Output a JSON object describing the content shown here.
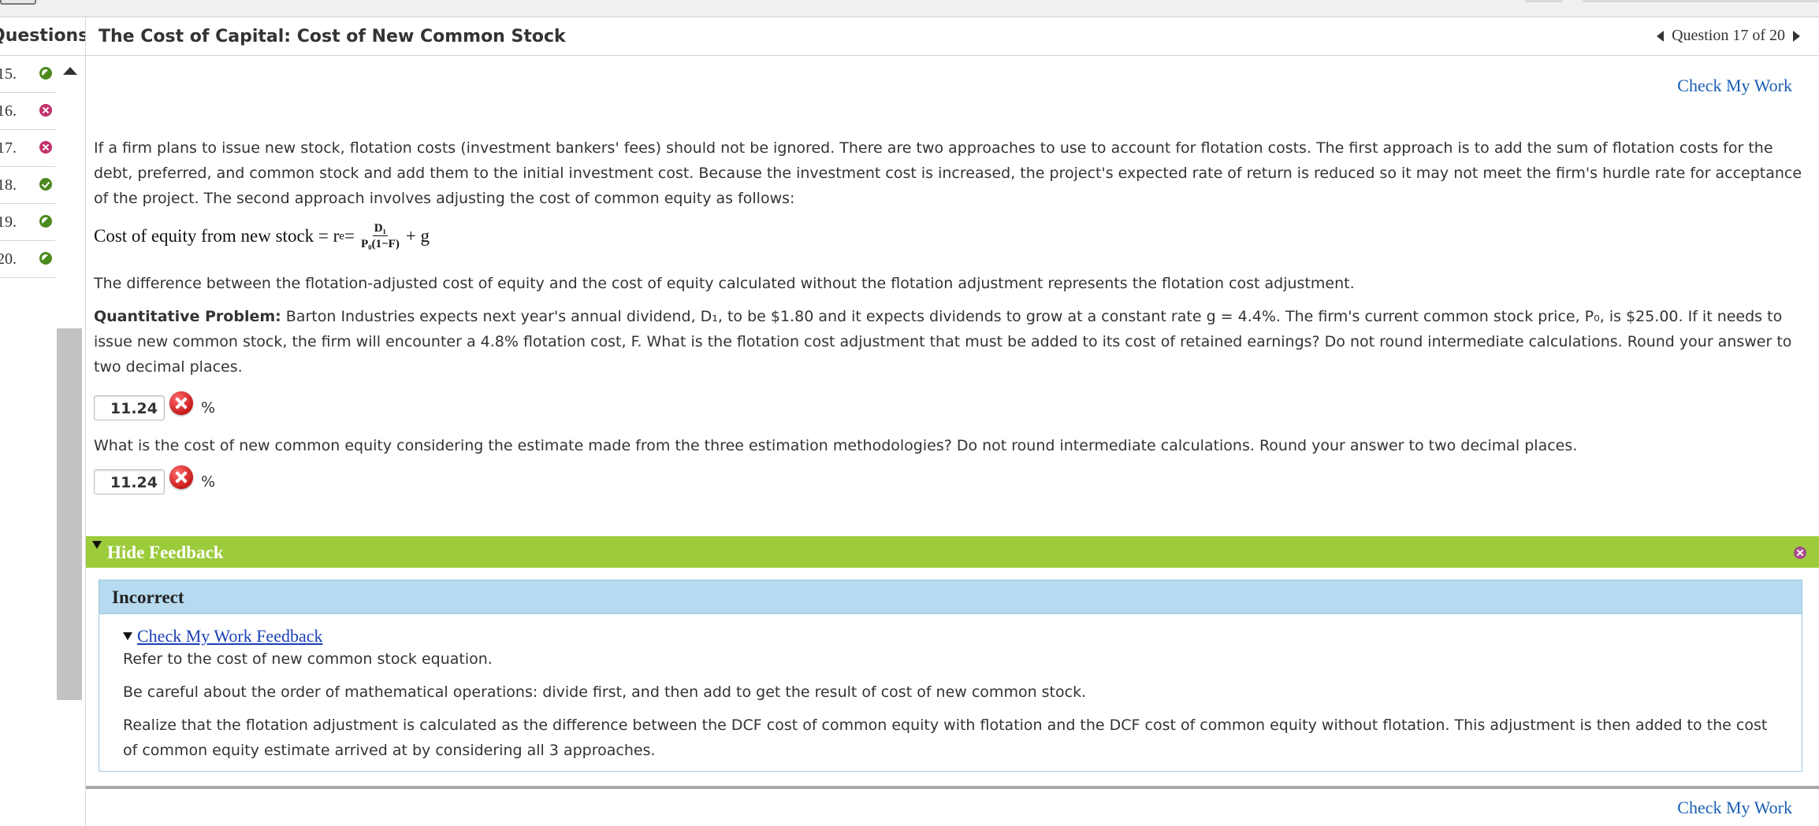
{
  "sidebar": {
    "header": "Questions",
    "items": [
      {
        "num": "15.",
        "status": "partial"
      },
      {
        "num": "16.",
        "status": "incorrect"
      },
      {
        "num": "17.",
        "status": "incorrect"
      },
      {
        "num": "18.",
        "status": "correct"
      },
      {
        "num": "19.",
        "status": "partial"
      },
      {
        "num": "20.",
        "status": "partial"
      }
    ]
  },
  "header": {
    "title": "The Cost of Capital: Cost of New Common Stock",
    "question_nav": "Question 17 of 20"
  },
  "check_my_work": "Check My Work",
  "body": {
    "intro": "If a firm plans to issue new stock, flotation costs (investment bankers' fees) should not be ignored. There are two approaches to use to account for flotation costs. The first approach is to add the sum of flotation costs for the debt, preferred, and common stock and add them to the initial investment cost. Because the investment cost is increased, the project's expected rate of return is reduced so it may not meet the firm's hurdle rate for acceptance of the project. The second approach involves adjusting the cost of common equity as follows:",
    "formula_lhs": "Cost of equity from new stock = r",
    "formula_sub": "e",
    "formula_eq": " = ",
    "formula_num": "D₁",
    "formula_den": "P₀(1−F)",
    "formula_rhs": "+ g",
    "difference": "The difference between the flotation-adjusted cost of equity and the cost of equity calculated without the flotation adjustment represents the flotation cost adjustment.",
    "problem_label": "Quantitative Problem:",
    "problem_text": " Barton Industries expects next year's annual dividend, D₁, to be $1.80 and it expects dividends to grow at a constant rate g = 4.4%. The firm's current common stock price, P₀, is $25.00. If it needs to issue new common stock, the firm will encounter a 4.8% flotation cost, F. What is the flotation cost adjustment that must be added to its cost of retained earnings? Do not round intermediate calculations. Round your answer to two decimal places.",
    "answer1": "11.24",
    "unit": "%",
    "question2": "What is the cost of new common equity considering the estimate made from the three estimation methodologies? Do not round intermediate calculations. Round your answer to two decimal places.",
    "answer2": "11.24"
  },
  "feedback": {
    "bar_title": "Hide Feedback",
    "result": "Incorrect",
    "sub_link": "Check My Work Feedback",
    "lines": [
      "Refer to the cost of new common stock equation.",
      "Be careful about the order of mathematical operations: divide first, and then add to get the result of cost of new common stock.",
      "Realize that the flotation adjustment is calculated as the difference between the DCF cost of common equity with flotation and the DCF cost of common equity without flotation. This adjustment is then added to the cost of common equity estimate arrived at by considering all 3 approaches."
    ]
  },
  "colors": {
    "feedback_bar": "#9ccb3b",
    "feedback_head": "#b6daf0",
    "link": "#1a5fb4",
    "incorrect": "#c2306a",
    "correct": "#4c8a1f"
  }
}
